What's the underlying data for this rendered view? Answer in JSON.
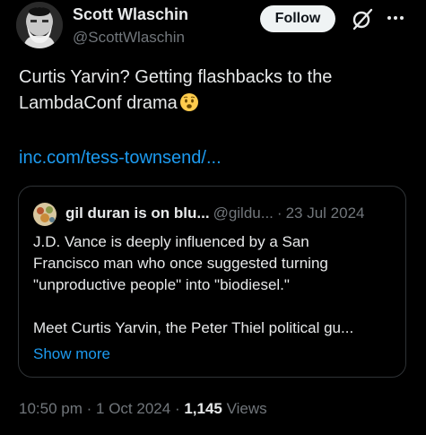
{
  "author": {
    "display_name": "Scott Wlaschin",
    "handle": "@ScottWlaschin"
  },
  "actions": {
    "follow_label": "Follow",
    "grok_icon": "grok-slash-icon",
    "more_icon": "more-horizontal-icon"
  },
  "tweet": {
    "text_line1": "Curtis Yarvin? Getting flashbacks to the",
    "text_line2": "LambdaConf drama",
    "emoji": "worried-face-emoji",
    "link": "inc.com/tess-townsend/..."
  },
  "quote": {
    "name": "gil duran is on blu...",
    "handle": "@gildu...",
    "date_sep": "·",
    "date": "23 Jul 2024",
    "body_line1": "J.D. Vance is deeply influenced by a San",
    "body_line2": "Francisco man who once suggested turning",
    "body_line3": "\"unproductive people\" into \"biodiesel.\"",
    "body_line4": "Meet Curtis Yarvin, the Peter Thiel political gu...",
    "show_more": "Show more"
  },
  "meta": {
    "time": "10:50 pm",
    "sep1": "·",
    "date": "1 Oct 2024",
    "sep2": "·",
    "views_count": "1,145",
    "views_label": "Views"
  },
  "colors": {
    "background": "#000000",
    "text": "#e7e9ea",
    "secondary": "#71767b",
    "link": "#1d9bf0",
    "border": "#2f3336"
  }
}
